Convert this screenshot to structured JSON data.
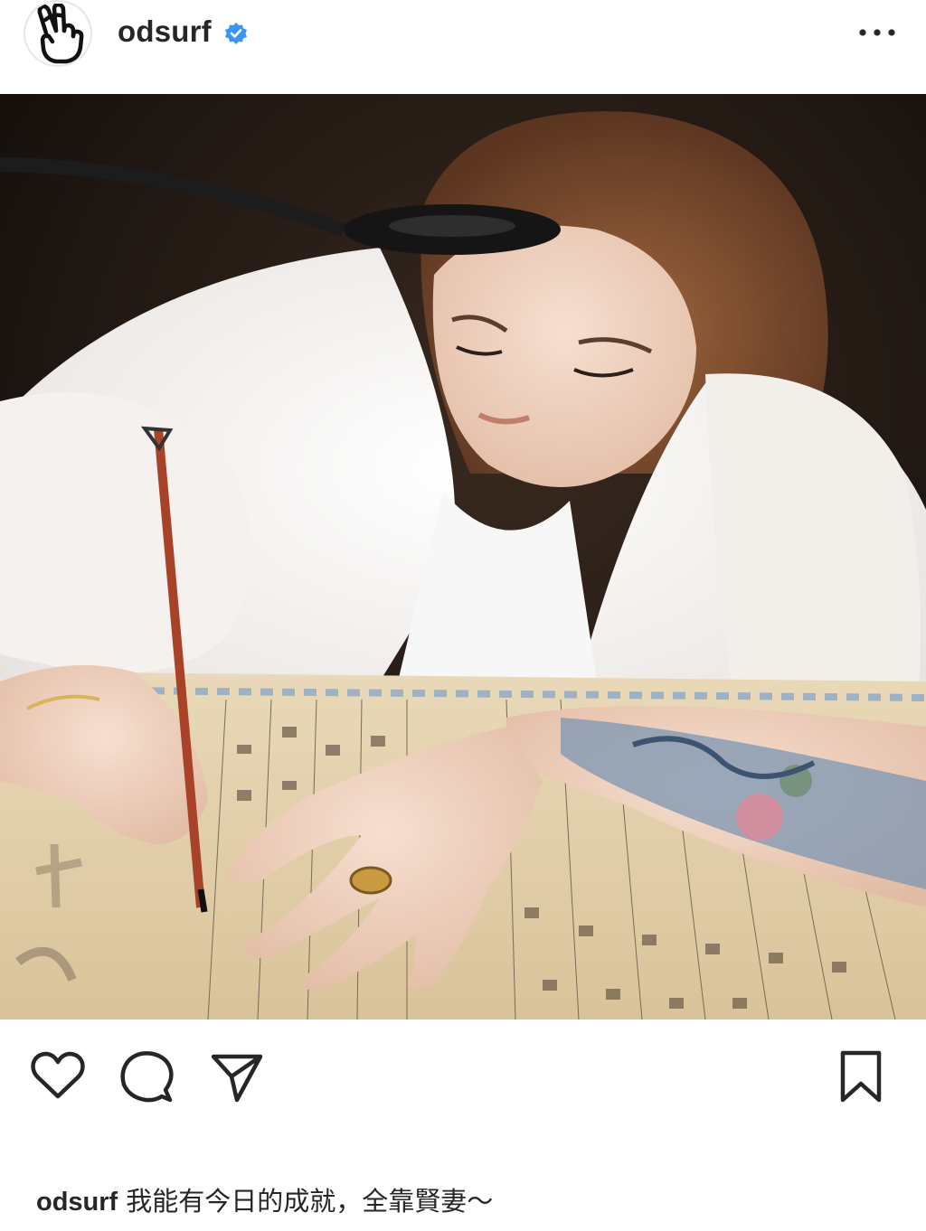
{
  "post": {
    "username": "odsurf",
    "verified": true,
    "caption_username": "odsurf",
    "caption_text": "我能有今日的成就，全靠賢妻～"
  },
  "icons": {
    "avatar": "fingers-crossed-hand-icon",
    "verified": "verified-badge-icon",
    "more": "more-options-icon",
    "like": "heart-icon",
    "comment": "comment-bubble-icon",
    "share": "paper-plane-icon",
    "save": "bookmark-icon"
  },
  "colors": {
    "verified_badge": "#3897f0",
    "icon_stroke": "#262626",
    "text": "#262626"
  }
}
